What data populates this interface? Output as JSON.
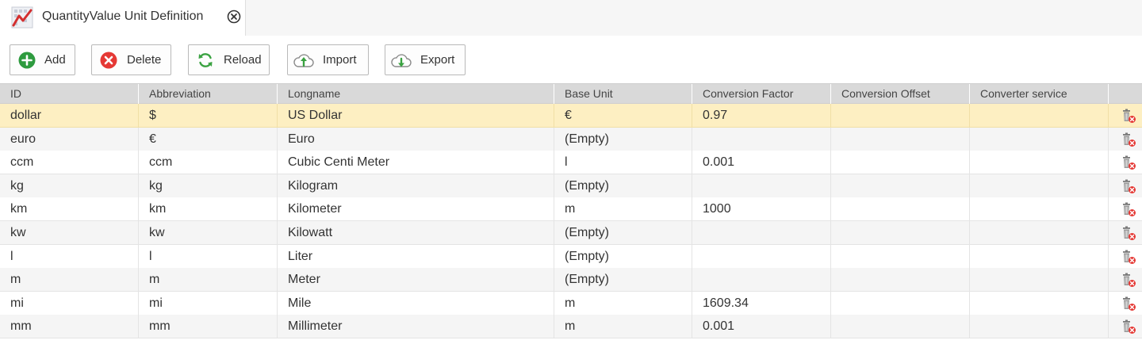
{
  "tab": {
    "title": "QuantityValue Unit Definition"
  },
  "toolbar": {
    "add_label": "Add",
    "delete_label": "Delete",
    "reload_label": "Reload",
    "import_label": "Import",
    "export_label": "Export"
  },
  "colors": {
    "add": "#2e9b3f",
    "delete": "#e53935",
    "reload": "#3aa241",
    "selected_row": "#fdefc2",
    "header_bg": "#d9d9d9"
  },
  "table": {
    "columns": [
      "ID",
      "Abbreviation",
      "Longname",
      "Base Unit",
      "Conversion Factor",
      "Conversion Offset",
      "Converter service"
    ],
    "rows": [
      [
        "dollar",
        "$",
        "US Dollar",
        "€",
        "0.97",
        "",
        ""
      ],
      [
        "euro",
        "€",
        "Euro",
        "(Empty)",
        "",
        "",
        ""
      ],
      [
        "ccm",
        "ccm",
        "Cubic Centi Meter",
        "l",
        "0.001",
        "",
        ""
      ],
      [
        "kg",
        "kg",
        "Kilogram",
        "(Empty)",
        "",
        "",
        ""
      ],
      [
        "km",
        "km",
        "Kilometer",
        "m",
        "1000",
        "",
        ""
      ],
      [
        "kw",
        "kw",
        "Kilowatt",
        "(Empty)",
        "",
        "",
        ""
      ],
      [
        "l",
        "l",
        "Liter",
        "(Empty)",
        "",
        "",
        ""
      ],
      [
        "m",
        "m",
        "Meter",
        "(Empty)",
        "",
        "",
        ""
      ],
      [
        "mi",
        "mi",
        "Mile",
        "m",
        "1609.34",
        "",
        ""
      ],
      [
        "mm",
        "mm",
        "Millimeter",
        "m",
        "0.001",
        "",
        ""
      ]
    ],
    "selected_row": 0,
    "row_icon": "delete-row-icon"
  }
}
